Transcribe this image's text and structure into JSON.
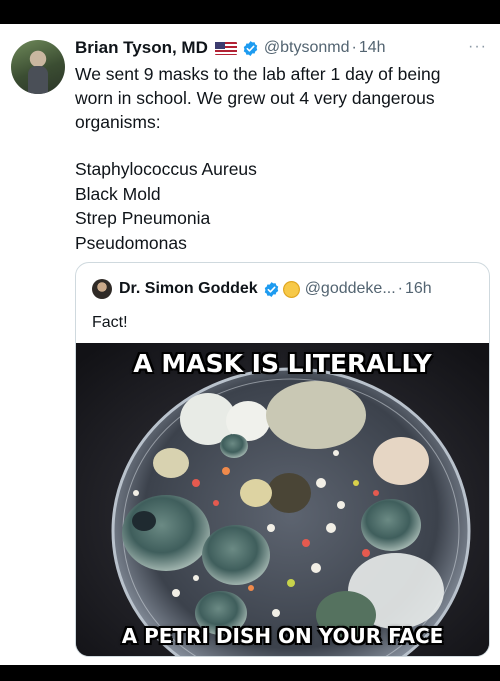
{
  "tweet": {
    "author_name": "Brian Tyson, MD",
    "handle": "@btysonmd",
    "separator": "·",
    "time": "14h",
    "more_label": "···",
    "text": "We sent 9 masks to the lab after 1 day of being worn in school.  We grew out 4 very dangerous organisms:",
    "organisms": [
      "Staphylococcus Aureus",
      "Black Mold",
      "Strep Pneumonia",
      "Pseudomonas"
    ],
    "quoted": {
      "author_name": "Dr. Simon Goddek",
      "handle": "@goddeke...",
      "separator": "·",
      "time": "16h",
      "text": "Fact!",
      "image_caption_top": "A MASK IS LITERALLY",
      "image_caption_bottom": "A PETRI DISH ON YOUR FACE"
    }
  },
  "icons": [
    "us-flag-icon",
    "verified-badge-icon",
    "more-options-icon",
    "emoji-icon"
  ],
  "colors": {
    "verified": "#1d9bf0",
    "secondary_text": "#536471",
    "border": "#cfd9de"
  }
}
